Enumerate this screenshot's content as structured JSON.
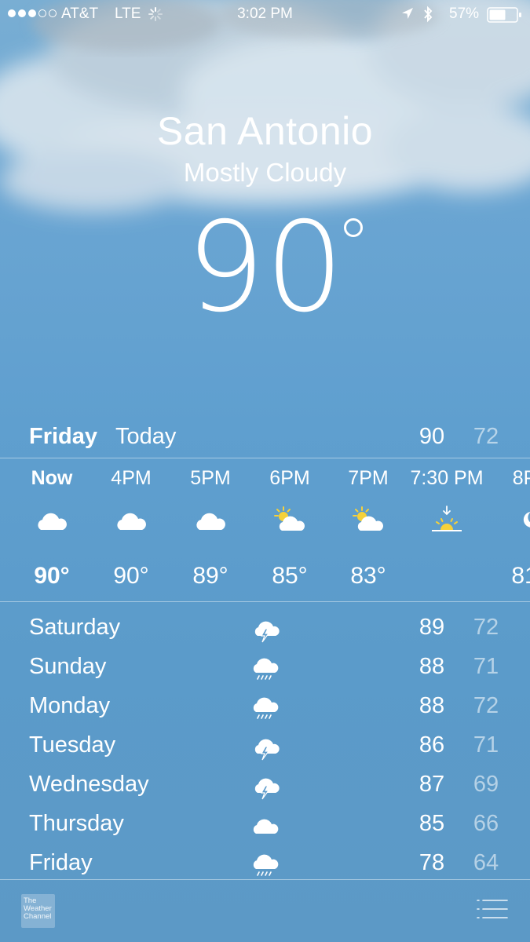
{
  "status_bar": {
    "carrier": "AT&T",
    "network": "LTE",
    "time": "3:02 PM",
    "battery": "57%",
    "signal_filled": 3,
    "signal_total": 5
  },
  "weather": {
    "city": "San Antonio",
    "condition": "Mostly Cloudy",
    "temperature": "90",
    "today": {
      "day": "Friday",
      "label": "Today",
      "high": "90",
      "low": "72"
    },
    "hourly": [
      {
        "time": "Now",
        "icon": "cloud-icon",
        "temp": "90°"
      },
      {
        "time": "4PM",
        "icon": "cloud-icon",
        "temp": "90°"
      },
      {
        "time": "5PM",
        "icon": "cloud-icon",
        "temp": "89°"
      },
      {
        "time": "6PM",
        "icon": "partly-sunny-icon",
        "temp": "85°"
      },
      {
        "time": "7PM",
        "icon": "partly-sunny-icon",
        "temp": "83°"
      },
      {
        "time": "7:30 PM",
        "icon": "sunset-icon",
        "temp": ""
      },
      {
        "time": "8P",
        "icon": "moon-cloud-icon",
        "temp": "81"
      }
    ],
    "daily": [
      {
        "day": "Saturday",
        "icon": "thunderstorm-icon",
        "high": "89",
        "low": "72"
      },
      {
        "day": "Sunday",
        "icon": "rain-icon",
        "high": "88",
        "low": "71"
      },
      {
        "day": "Monday",
        "icon": "rain-icon",
        "high": "88",
        "low": "72"
      },
      {
        "day": "Tuesday",
        "icon": "thunderstorm-icon",
        "high": "86",
        "low": "71"
      },
      {
        "day": "Wednesday",
        "icon": "thunderstorm-icon",
        "high": "87",
        "low": "69"
      },
      {
        "day": "Thursday",
        "icon": "cloud-icon",
        "high": "85",
        "low": "66"
      },
      {
        "day": "Friday",
        "icon": "rain-icon",
        "high": "78",
        "low": "64"
      }
    ]
  },
  "footer": {
    "logo_lines": [
      "The",
      "Weather",
      "Channel"
    ],
    "list_icon": "list-icon"
  }
}
